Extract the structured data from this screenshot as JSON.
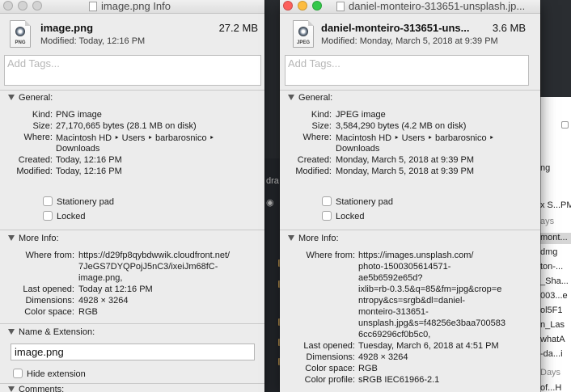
{
  "background": {
    "editor_glyphs": [
      "dra",
      "",
      ""
    ],
    "finder_rows": [
      "ng",
      "x S...PM",
      "ays",
      "mont...",
      "dmg",
      "ton-...",
      "_Sha...",
      "003...e",
      "ol5F1",
      "n_Las",
      "whatA",
      "-da...i",
      "Days",
      "of...H"
    ]
  },
  "left": {
    "title": "image.png Info",
    "icon_ext": "PNG",
    "file_name": "image.png",
    "file_size": "27.2 MB",
    "modified_line": "Modified: Today, 12:16 PM",
    "tags_placeholder": "Add Tags...",
    "general_label": "General:",
    "general": {
      "kind_label": "Kind:",
      "kind": "PNG image",
      "size_label": "Size:",
      "size": "27,170,665 bytes (28.1 MB on disk)",
      "where_label": "Where:",
      "where1": "Macintosh HD ‣ Users ‣ barbarosnico ‣",
      "where2": "Downloads",
      "created_label": "Created:",
      "created": "Today, 12:16 PM",
      "modified_label": "Modified:",
      "modified": "Today, 12:16 PM"
    },
    "stationery_label": "Stationery pad",
    "locked_label": "Locked",
    "more_info_label": "More Info:",
    "more": {
      "where_from_label": "Where from:",
      "where_from": [
        "https://d29fp8qybdwwik.cloudfront.net/",
        "7JeGS7DYQPojJ5nC3/ixeiJm68fC-",
        "image.png,"
      ],
      "last_opened_label": "Last opened:",
      "last_opened": "Today at 12:16 PM",
      "dimensions_label": "Dimensions:",
      "dimensions": "4928 × 3264",
      "color_space_label": "Color space:",
      "color_space": "RGB"
    },
    "name_ext_label": "Name & Extension:",
    "name_value": "image.png",
    "hide_ext_label": "Hide extension",
    "comments_label": "Comments:"
  },
  "right": {
    "title": "daniel-monteiro-313651-unsplash.jp...",
    "icon_ext": "JPEG",
    "file_name": "daniel-monteiro-313651-uns...",
    "file_size": "3.6 MB",
    "modified_line": "Modified: Monday, March 5, 2018 at 9:39 PM",
    "tags_placeholder": "Add Tags...",
    "general_label": "General:",
    "general": {
      "kind_label": "Kind:",
      "kind": "JPEG image",
      "size_label": "Size:",
      "size": "3,584,290 bytes (4.2 MB on disk)",
      "where_label": "Where:",
      "where1": "Macintosh HD ‣ Users ‣ barbarosnico ‣",
      "where2": "Downloads",
      "created_label": "Created:",
      "created": "Monday, March 5, 2018 at 9:39 PM",
      "modified_label": "Modified:",
      "modified": "Monday, March 5, 2018 at 9:39 PM"
    },
    "stationery_label": "Stationery pad",
    "locked_label": "Locked",
    "more_info_label": "More Info:",
    "more": {
      "where_from_label": "Where from:",
      "where_from": [
        "https://images.unsplash.com/",
        "photo-1500305614571-",
        "ae5b6592e65d?",
        "ixlib=rb-0.3.5&q=85&fm=jpg&crop=e",
        "ntropy&cs=srgb&dl=daniel-",
        "monteiro-313651-",
        "unsplash.jpg&s=f48256e3baa700583",
        "6cc69296cf0b5c0,"
      ],
      "last_opened_label": "Last opened:",
      "last_opened": "Tuesday, March 6, 2018 at 4:51 PM",
      "dimensions_label": "Dimensions:",
      "dimensions": "4928 × 3264",
      "color_space_label": "Color space:",
      "color_space": "RGB",
      "color_profile_label": "Color profile:",
      "color_profile": "sRGB IEC61966-2.1"
    }
  }
}
